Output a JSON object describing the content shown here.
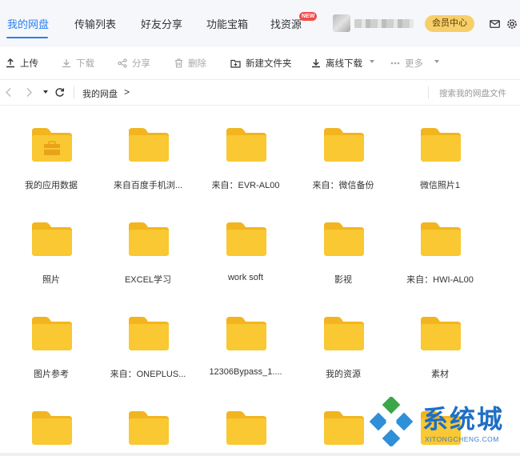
{
  "nav": {
    "tabs": [
      {
        "label": "我的网盘"
      },
      {
        "label": "传输列表"
      },
      {
        "label": "好友分享"
      },
      {
        "label": "功能宝箱"
      },
      {
        "label": "找资源"
      }
    ],
    "active_tab": "我的网盘",
    "new_badge": "NEW",
    "vip_button": "会员中心"
  },
  "toolbar": {
    "upload": "上传",
    "download": "下载",
    "share": "分享",
    "delete": "删除",
    "new_folder": "新建文件夹",
    "offline_download": "离线下载",
    "more": "更多"
  },
  "address": {
    "breadcrumb": "我的网盘",
    "separator": ">",
    "search_placeholder": "搜索我的网盘文件"
  },
  "folders": [
    {
      "name": "我的应用数据"
    },
    {
      "name": "来自百度手机浏..."
    },
    {
      "name": "来自：EVR-AL00"
    },
    {
      "name": "来自：微信备份"
    },
    {
      "name": "微信照片1"
    },
    {
      "name": "照片"
    },
    {
      "name": "EXCEL学习"
    },
    {
      "name": "work soft"
    },
    {
      "name": "影视"
    },
    {
      "name": "来自：HWI-AL00"
    },
    {
      "name": "图片参考"
    },
    {
      "name": "来自：ONEPLUS..."
    },
    {
      "name": "12306Bypass_1...."
    },
    {
      "name": "我的资源"
    },
    {
      "name": "素材"
    },
    {
      "name": ""
    },
    {
      "name": ""
    },
    {
      "name": ""
    },
    {
      "name": ""
    },
    {
      "name": ""
    }
  ],
  "watermark": {
    "text": "系统城",
    "url": "XITONGCHENG.COM"
  },
  "colors": {
    "accent": "#2a7ef0",
    "folder": "#f9c832",
    "folder_back": "#f2b51f",
    "vip": "#f7cf6a"
  }
}
